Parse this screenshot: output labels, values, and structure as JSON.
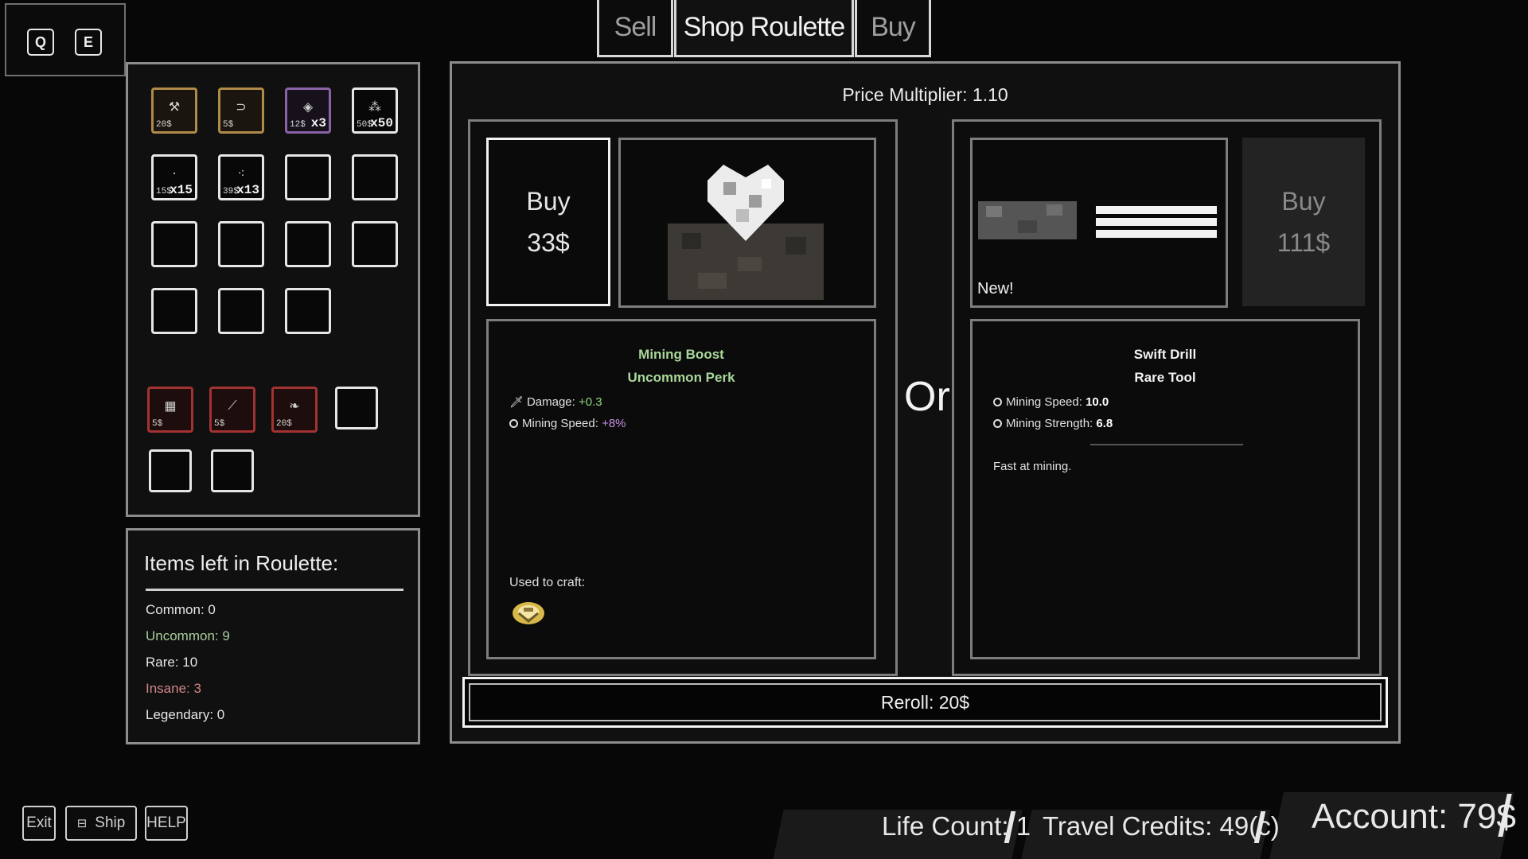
{
  "keys": [
    "Q",
    "E"
  ],
  "tabs": [
    {
      "label": "Sell",
      "active": false
    },
    {
      "label": "Shop Roulette",
      "active": true
    },
    {
      "label": "Buy",
      "active": false
    }
  ],
  "inventory": {
    "slots": [
      {
        "price": "20$",
        "qty": "",
        "style": "gold",
        "icon": "pickaxe-icon"
      },
      {
        "price": "5$",
        "qty": "",
        "style": "gold",
        "icon": "magnet-icon"
      },
      {
        "price": "12$",
        "qty": "x3",
        "style": "purple",
        "icon": "gem-icon"
      },
      {
        "price": "50$",
        "qty": "x50",
        "style": "plain",
        "icon": "ore-icon"
      },
      {
        "price": "15$",
        "qty": "x15",
        "style": "plain",
        "icon": "rock-icon"
      },
      {
        "price": "39$",
        "qty": "x13",
        "style": "plain",
        "icon": "nugget-icon"
      }
    ],
    "perk_slots": [
      {
        "price": "5$",
        "style": "red",
        "icon": "grid-icon"
      },
      {
        "price": "5$",
        "style": "red",
        "icon": "boot-icon"
      },
      {
        "price": "20$",
        "style": "red",
        "icon": "leaf-icon"
      }
    ]
  },
  "roulette": {
    "title": "Items left in Roulette:",
    "items": [
      {
        "label": "Common: 0",
        "color": "#e6e6e6"
      },
      {
        "label": "Uncommon: 9",
        "color": "#a9cc9a"
      },
      {
        "label": "Rare: 10",
        "color": "#e6e6e6"
      },
      {
        "label": "Insane: 3",
        "color": "#d28787"
      },
      {
        "label": "Legendary: 0",
        "color": "#e6e6e6"
      }
    ]
  },
  "price_multiplier": "Price Multiplier: 1.10",
  "left_offer": {
    "buy_label": "Buy",
    "price": "33$",
    "icon": "heart-ore-icon",
    "name": "Mining Boost",
    "rarity": "Uncommon Perk",
    "name_color": "#a9d99a",
    "stats": [
      {
        "icon": "sword-icon",
        "label": "Damage:",
        "value": "+0.3",
        "value_color": "#8fd67d"
      },
      {
        "icon": "circle-icon",
        "label": "Mining Speed:",
        "value": "+8%",
        "value_color": "#c690e0"
      }
    ],
    "craft_label": "Used to craft:",
    "craft_icon": "crafted-item-icon"
  },
  "or_label": "Or",
  "right_offer": {
    "buy_label": "Buy",
    "price": "111$",
    "icon": "drill-icon",
    "new_badge": "New!",
    "name": "Swift Drill",
    "rarity": "Rare Tool",
    "name_color": "#f2f2f2",
    "stats": [
      {
        "icon": "circle-icon",
        "label": "Mining Speed:",
        "value": "10.0",
        "value_color": "#ffffff"
      },
      {
        "icon": "circle-icon",
        "label": "Mining Strength:",
        "value": "6.8",
        "value_color": "#ffffff"
      }
    ],
    "description": "Fast at mining."
  },
  "reroll_label": "Reroll: 20$",
  "bottom_left": {
    "exit": "Exit",
    "ship": "Ship",
    "help": "HELP"
  },
  "status": {
    "life_count": "Life Count: 1",
    "travel_credits": "Travel Credits: 49(c)",
    "account": "Account: 79$"
  }
}
